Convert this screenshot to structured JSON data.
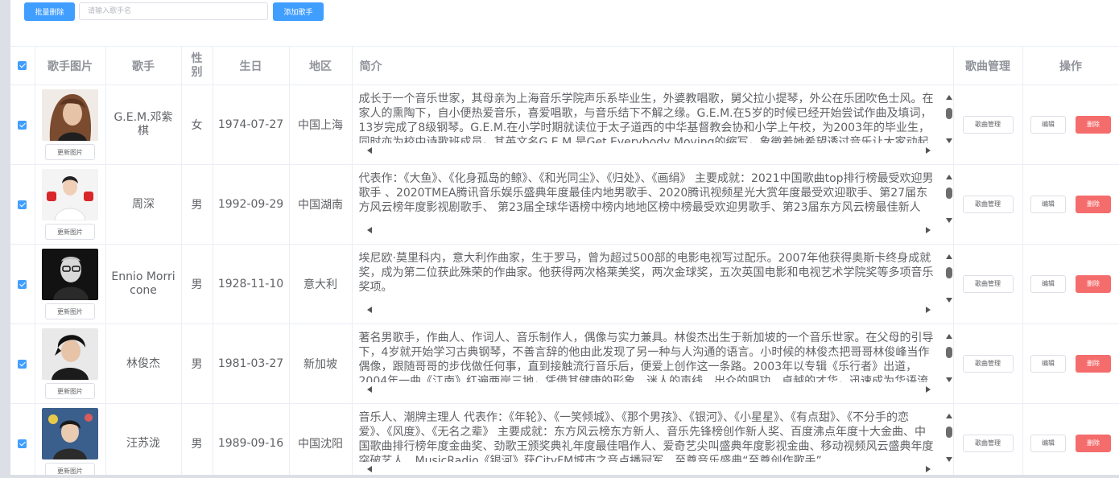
{
  "toolbar": {
    "batch_delete_label": "批量删除",
    "search_placeholder": "请输入歌手名",
    "add_singer_label": "添加歌手"
  },
  "table": {
    "headers": {
      "pic": "歌手图片",
      "name": "歌手",
      "sex": "性别",
      "birth": "生日",
      "location": "地区",
      "intro": "简介",
      "song_manage": "歌曲管理",
      "ops": "操作"
    },
    "row_buttons": {
      "update_pic": "更新图片",
      "song_manage": "歌曲管理",
      "edit": "编辑",
      "delete": "删除"
    },
    "rows": [
      {
        "checked": true,
        "name": "G.E.M.邓紫棋",
        "sex": "女",
        "birth": "1974-07-27",
        "location": "中国上海",
        "intro": "成长于一个音乐世家，其母亲为上海音乐学院声乐系毕业生，外婆教唱歌，舅父拉小提琴，外公在乐团吹色士风。在家人的熏陶下，自小便热爱音乐，喜爱唱歌，与音乐结下不解之缘。G.E.M.在5岁的时候已经开始尝试作曲及填词，13岁完成了8级钢琴。G.E.M.在小学时期就读位于太子道西的中华基督教会协和小学上午校，为2003年的毕业生，同时亦为校中诗歌班成员。其英文名G.E.M.是Get Everybody Moving的缩写，象徵着她希望透过音乐让大家动起来。",
        "photo_icon": "singer-photo-gem"
      },
      {
        "checked": true,
        "name": "周深",
        "sex": "男",
        "birth": "1992-09-29",
        "location": "中国湖南",
        "intro": "代表作：《大鱼》、《化身孤岛的鲸》、《和光同尘》、《归处》、《画绢》 主要成就：2021中国歌曲top排行榜最受欢迎男歌手 、2020TMEA腾讯音乐娱乐盛典年度最佳内地男歌手、2020腾讯视频星光大赏年度最受欢迎歌手、第27届东方风云榜年度影视剧歌手、 第23届全球华语榜中榜内地地区榜中榜最受欢迎男歌手、第23届东方风云榜最佳新人",
        "photo_icon": "singer-photo-zhoushen"
      },
      {
        "checked": true,
        "name": "Ennio Morricone",
        "sex": "男",
        "birth": "1928-11-10",
        "location": "意大利",
        "intro": "埃尼欧·莫里科内，意大利作曲家，生于罗马，曾为超过500部的电影电视写过配乐。2007年他获得奥斯卡终身成就奖，成为第二位获此殊荣的作曲家。他获得两次格莱美奖，两次金球奖，五次英国电影和电视艺术学院奖等多项音乐奖项。",
        "photo_icon": "singer-photo-morricone"
      },
      {
        "checked": true,
        "name": "林俊杰",
        "sex": "男",
        "birth": "1981-03-27",
        "location": "新加坡",
        "intro": "著名男歌手，作曲人、作词人、音乐制作人，偶像与实力兼具。林俊杰出生于新加坡的一个音乐世家。在父母的引导下，4岁就开始学习古典钢琴，不善言辞的他由此发现了另一种与人沟通的语言。小时候的林俊杰把哥哥林俊峰当作偶像，跟随哥哥的步伐做任何事，直到接触流行音乐后，便爱上创作这一条路。2003年以专辑《乐行者》出道，2004年一曲《江南》红遍两岸三地，凭借其健康的形象、迷人的声线、出众的唱功、卓越的才华，迅速成为华语流行乐坛的领军人物。",
        "photo_icon": "singer-photo-jj"
      },
      {
        "checked": true,
        "name": "汪苏泷",
        "sex": "男",
        "birth": "1989-09-16",
        "location": "中国沈阳",
        "intro": "音乐人、潮牌主理人 代表作：《年轮》、《一笑倾城》、《那个男孩》、《银河》、《小星星》、《有点甜》、《不分手的恋爱》、《风度》、《无名之辈》 主要成就：东方风云榜东方新人、音乐先锋榜创作新人奖、百度沸点年度十大金曲、中国歌曲排行榜年度金曲奖、劲歌王颁奖典礼年度最佳唱作人、爱奇艺尖叫盛典年度影视金曲、移动视频风云盛典年度突破艺人、MusicRadio《银河》获CityFM城市之音点播冠军、至尊音乐盛典“至尊创作歌手”",
        "photo_icon": "singer-photo-silence"
      }
    ]
  }
}
